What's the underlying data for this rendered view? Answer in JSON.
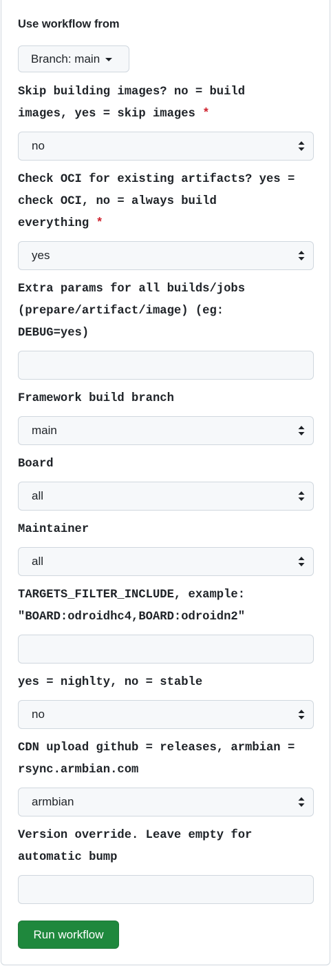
{
  "workflow_from_label": "Use workflow from",
  "branch_button": "Branch: main",
  "required_mark": "*",
  "fields": {
    "skip_images": {
      "label_lines": [
        "Skip building images? no = build",
        "images, yes = skip images"
      ],
      "value": "no"
    },
    "check_oci": {
      "label_lines": [
        "Check OCI for existing artifacts? yes =",
        "check OCI, no = always build",
        "everything"
      ],
      "value": "yes"
    },
    "extra_params": {
      "label_lines": [
        "Extra params for all builds/jobs",
        "(prepare/artifact/image) (eg:",
        "DEBUG=yes)"
      ],
      "value": ""
    },
    "framework_branch": {
      "label": "Framework build branch",
      "value": "main"
    },
    "board": {
      "label": "Board",
      "value": "all"
    },
    "maintainer": {
      "label": "Maintainer",
      "value": "all"
    },
    "targets_filter": {
      "label_lines": [
        "TARGETS_FILTER_INCLUDE, example:",
        "\"BOARD:odroidhc4,BOARD:odroidn2\""
      ],
      "value": ""
    },
    "nightly": {
      "label": "yes = nighlty, no = stable",
      "value": "no"
    },
    "cdn_upload": {
      "label_lines": [
        "CDN upload github = releases, armbian =",
        "rsync.armbian.com"
      ],
      "value": "armbian"
    },
    "version_override": {
      "label_lines": [
        "Version override. Leave empty for",
        "automatic bump"
      ],
      "value": ""
    }
  },
  "run_button": "Run workflow",
  "icons": {
    "select_arrows": "select-arrows-icon",
    "caret": "caret-down-icon"
  },
  "colors": {
    "primary": "#1f883d",
    "required": "#cf222e",
    "field_bg": "#f6f8fa",
    "border": "#d0d7de"
  }
}
